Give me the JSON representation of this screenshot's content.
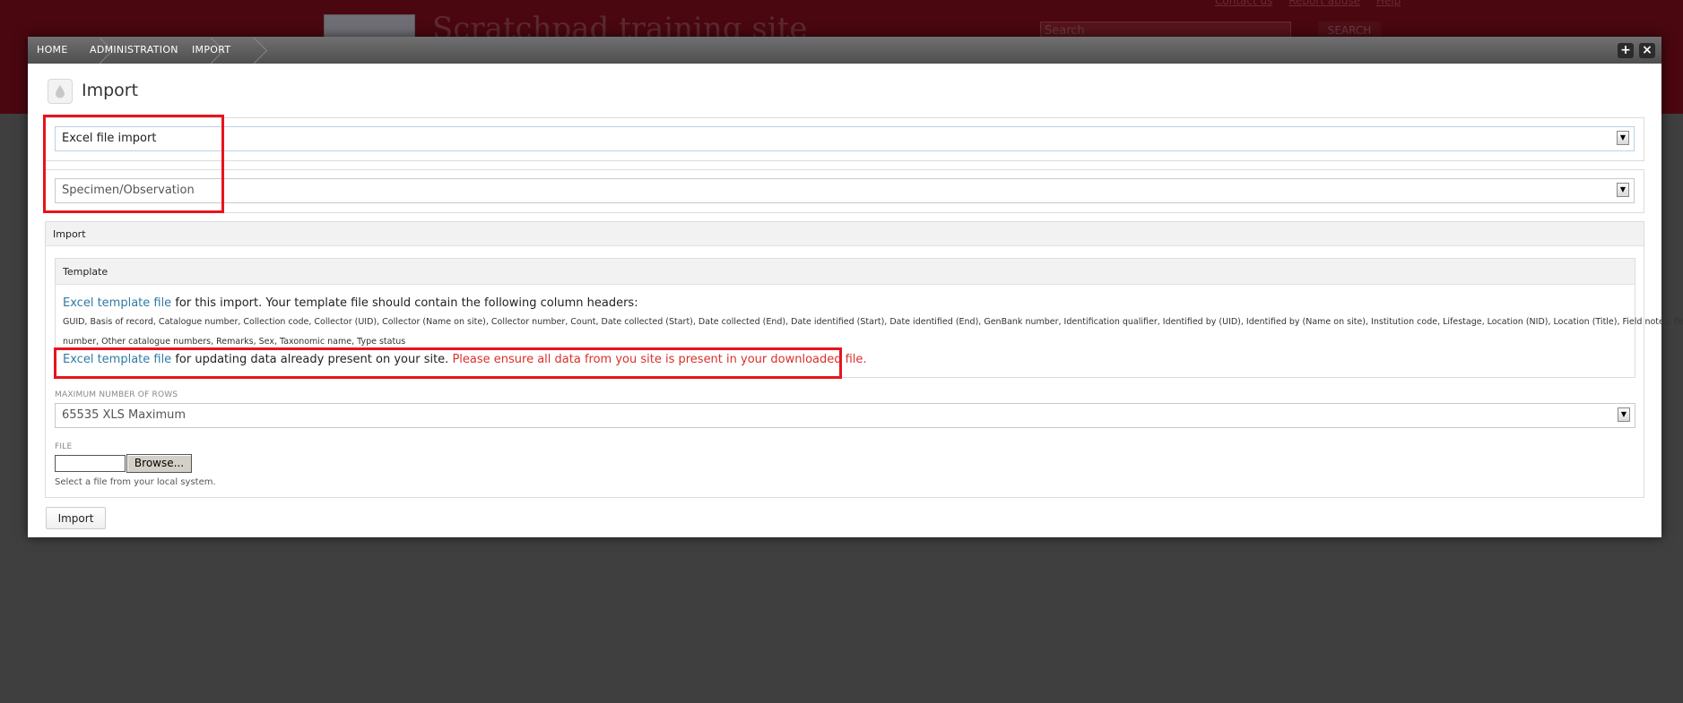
{
  "site": {
    "title": "Scratchpad training site",
    "links": [
      "Contact us",
      "Report abuse",
      "Help"
    ],
    "search_placeholder": "Search",
    "search_button": "SEARCH"
  },
  "breadcrumbs": [
    "HOME",
    "ADMINISTRATION",
    "IMPORT"
  ],
  "toolbar": {
    "expand_icon": "+",
    "close_icon": "×"
  },
  "page": {
    "title": "Import"
  },
  "import_type": {
    "selected": "Excel file import"
  },
  "content_type": {
    "selected": "Specimen/Observation"
  },
  "import_section": {
    "legend": "Import"
  },
  "template": {
    "legend": "Template",
    "link_text": "Excel template file",
    "description": " for this import. Your template file should contain the following column headers:",
    "columns_line1": "GUID, Basis of record, Catalogue number, Collection code, Collector (UID), Collector (Name on site), Collector number, Count, Date collected (Start), Date collected (End), Date identified (Start), Date identified (End), GenBank number, Identification qualifier, Identified by (UID), Identified by (Name on site), Institution code, Lifestage, Location (NID), Location (Title), Field notes, Field",
    "columns_line2": "number, Other catalogue numbers, Remarks, Sex, Taxonomic name, Type status",
    "update_link_text": "Excel template file",
    "update_description": " for updating data already present on your site. ",
    "update_warning": "Please ensure all data from you site is present in your downloaded file."
  },
  "max_rows": {
    "label": "MAXIMUM NUMBER OF ROWS",
    "selected": "65535 XLS Maximum"
  },
  "file": {
    "label": "FILE",
    "browse_button": "Browse...",
    "description": "Select a file from your local system."
  },
  "submit": {
    "label": "Import"
  },
  "colors": {
    "site_header": "#4a0710",
    "link": "#2f7aa5",
    "warning": "#d9302a",
    "highlight": "#e8141c"
  }
}
